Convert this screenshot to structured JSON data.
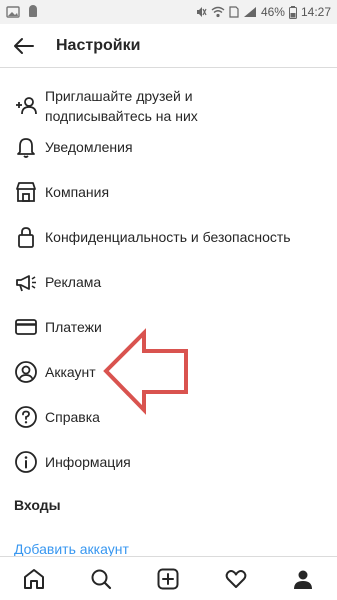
{
  "status_bar": {
    "battery": "46%",
    "time": "14:27"
  },
  "header": {
    "title": "Настройки",
    "back_icon": "arrow-left-icon"
  },
  "menu_items": [
    {
      "icon": "add-person-icon",
      "label": "Приглашайте друзей и подписывайтесь на них"
    },
    {
      "icon": "bell-icon",
      "label": "Уведомления"
    },
    {
      "icon": "shop-icon",
      "label": "Компания"
    },
    {
      "icon": "lock-icon",
      "label": "Конфиденциальность и безопасность"
    },
    {
      "icon": "megaphone-icon",
      "label": "Реклама"
    },
    {
      "icon": "card-icon",
      "label": "Платежи"
    },
    {
      "icon": "account-icon",
      "label": "Аккаунт"
    },
    {
      "icon": "help-icon",
      "label": "Справка"
    },
    {
      "icon": "info-icon",
      "label": "Информация"
    }
  ],
  "logins_section": {
    "title": "Входы",
    "add_account": "Добавить аккаунт"
  },
  "bottom_nav": [
    "home-icon",
    "search-icon",
    "add-post-icon",
    "activity-heart-icon",
    "profile-icon"
  ],
  "colors": {
    "annotation_arrow": "#d9534f",
    "link": "#3897f0"
  }
}
